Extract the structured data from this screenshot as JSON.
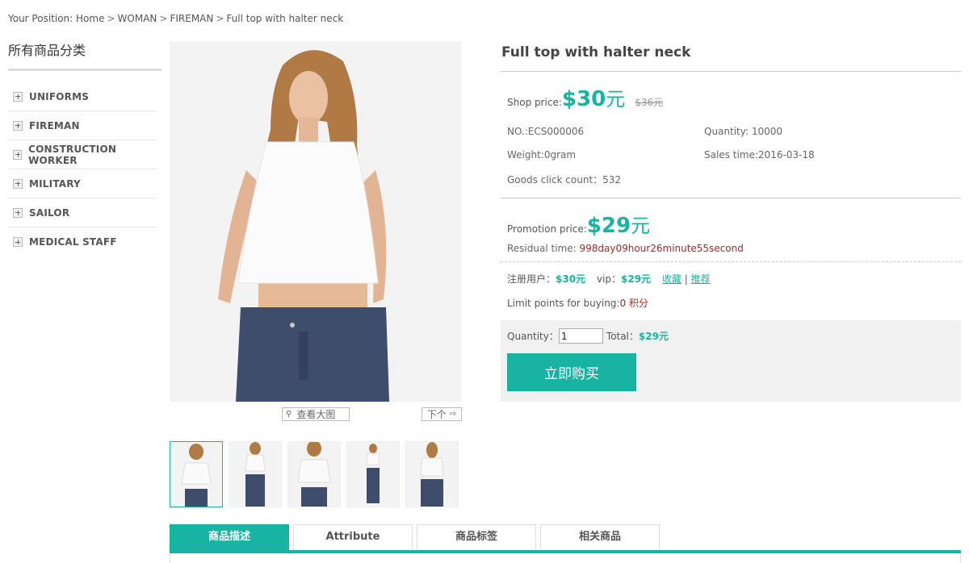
{
  "breadcrumb": {
    "prefix": "Your Position:",
    "items": [
      "Home",
      "WOMAN",
      "FIREMAN",
      "Full top with halter neck"
    ],
    "separator": ">"
  },
  "sidebar": {
    "title": "所有商品分类",
    "categories": [
      "UNIFORMS",
      "FIREMAN",
      "CONSTRUCTION WORKER",
      "MILITARY",
      "SAILOR",
      "MEDICAL STAFF"
    ]
  },
  "gallery": {
    "zoom_label": "查看大图",
    "next_label": "下个",
    "thumb_count": 5
  },
  "product": {
    "title": "Full top with halter neck",
    "shop_price_label": "Shop price:",
    "shop_price": "$30",
    "shop_price_unit": "元",
    "market_price": "$36元",
    "no_label": "NO.:ECS000006",
    "quantity_label": "Quantity: 10000",
    "weight_label": "Weight:0gram",
    "sales_time_label": "Sales time:2016-03-18",
    "click_count_label": "Goods click count：532",
    "promo_label": "Promotion price:",
    "promo_price": "$29",
    "promo_unit": "元",
    "residual_label": "Residual time: ",
    "residual_value": "998day09hour26minute55second",
    "member_label": "注册用户：",
    "member_price": "$30元",
    "vip_label": "vip：",
    "vip_price": "$29元",
    "favorite_link": "收藏",
    "divider": "|",
    "recommend_link": "推荐",
    "limit_label": "Limit points for buying:",
    "limit_value": "0 积分"
  },
  "buy": {
    "quantity_label": "Quantity：",
    "quantity_value": "1",
    "total_label": "Total：",
    "total_value": "$29元",
    "buy_button": "立即购买"
  },
  "tabs": [
    "商品描述",
    "Attribute",
    "商品标签",
    "相关商品"
  ],
  "colors": {
    "accent": "#17b3a3",
    "red": "#a52a2a"
  }
}
